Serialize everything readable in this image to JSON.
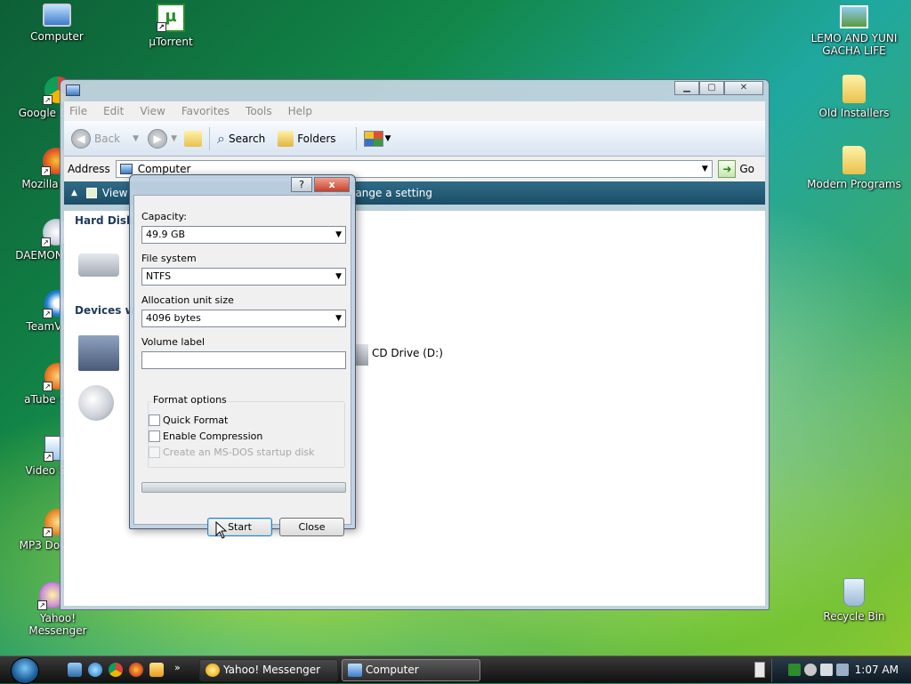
{
  "desktop": {
    "icons_left": [
      {
        "label": "Computer"
      },
      {
        "label": "µTorrent"
      },
      {
        "label": "Google C"
      },
      {
        "label": "Mozilla"
      },
      {
        "label": "DAEMON"
      },
      {
        "label": "TeamVi"
      },
      {
        "label": "aTube C"
      },
      {
        "label": "Video S"
      },
      {
        "label": "MP3 Dov"
      },
      {
        "label": "Yahoo! Messenger"
      }
    ],
    "icons_right": [
      {
        "label": "LEMO AND YUNI GACHA LIFE"
      },
      {
        "label": "Old Installers"
      },
      {
        "label": "Modern Programs"
      },
      {
        "label": "Recycle Bin"
      }
    ]
  },
  "explorer": {
    "menu": [
      "File",
      "Edit",
      "View",
      "Favorites",
      "Tools",
      "Help"
    ],
    "toolbar": {
      "back": "Back",
      "search": "Search",
      "folders": "Folders"
    },
    "address": {
      "label": "Address",
      "value": "Computer",
      "go": "Go"
    },
    "tasks": {
      "view": "View s",
      "change_setting": "Change a setting"
    },
    "groups": {
      "hard_disk": "Hard Disk I",
      "devices": "Devices wi"
    },
    "cd_drive": "CD Drive (D:)"
  },
  "format_dialog": {
    "help_button": "?",
    "close_x": "x",
    "capacity_label": "Capacity:",
    "capacity_value": "49.9 GB",
    "filesystem_label": "File system",
    "filesystem_value": "NTFS",
    "allocation_label": "Allocation unit size",
    "allocation_value": "4096 bytes",
    "volume_label": "Volume label",
    "volume_value": "",
    "format_options_label": "Format options",
    "quick_format": "Quick Format",
    "enable_compression": "Enable Compression",
    "msdos_disk": "Create an MS-DOS startup disk",
    "progress": 0.0,
    "start_button": "Start",
    "close_button": "Close"
  },
  "taskbar": {
    "tasks": [
      {
        "label": "Yahoo! Messenger"
      },
      {
        "label": "Computer"
      }
    ],
    "clock": "1:07 AM"
  },
  "colors": {
    "window_tint": "#c8d6e4",
    "tasks_bar": "#1b4d66",
    "progress_green": "#37c137"
  }
}
